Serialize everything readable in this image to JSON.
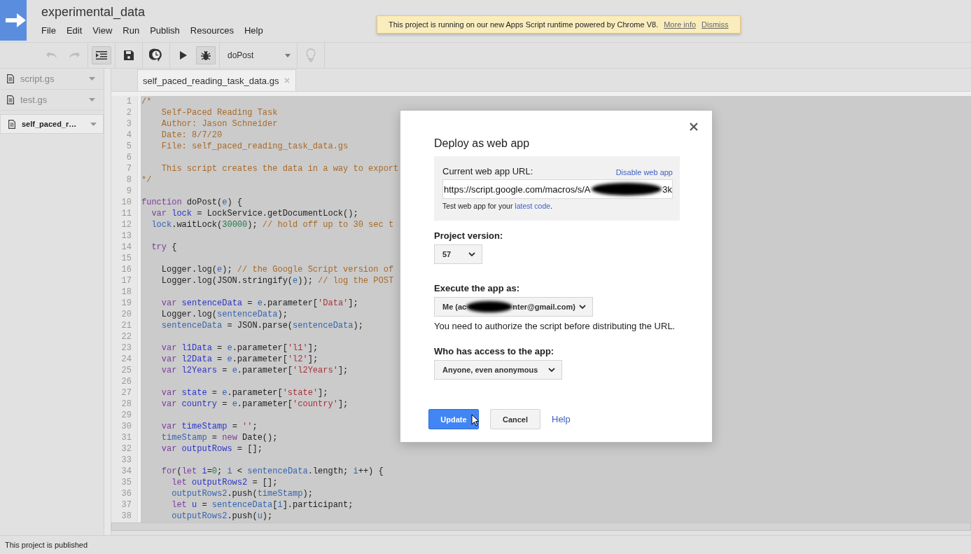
{
  "app": {
    "title": "experimental_data",
    "menu": [
      "File",
      "Edit",
      "View",
      "Run",
      "Publish",
      "Resources",
      "Help"
    ]
  },
  "notice": {
    "text": "This project is running on our new Apps Script runtime powered by Chrome V8.",
    "links": [
      "More info",
      "Dismiss"
    ]
  },
  "toolbar": {
    "buttons": [
      {
        "kind": "undo",
        "disabled": true,
        "pressed": false
      },
      {
        "kind": "redo",
        "disabled": true,
        "pressed": false
      },
      {
        "kind": "indent",
        "disabled": false,
        "pressed": true
      },
      {
        "kind": "save",
        "disabled": false,
        "pressed": false
      },
      {
        "kind": "triggers",
        "disabled": false,
        "pressed": false
      },
      {
        "kind": "run",
        "disabled": false,
        "pressed": false
      },
      {
        "kind": "debug",
        "disabled": false,
        "pressed": true
      },
      {
        "kind": "function",
        "label": "doPost"
      },
      {
        "kind": "hint",
        "disabled": true,
        "pressed": false
      }
    ]
  },
  "files": [
    {
      "name": "script.gs",
      "selected": false
    },
    {
      "name": "test.gs",
      "selected": false
    },
    {
      "name": "self_paced_r…",
      "selected": true
    }
  ],
  "editor": {
    "tab": "self_paced_reading_task_data.gs",
    "lines": [
      {
        "number": "1",
        "segments": [
          {
            "kind": "com",
            "text": "/*"
          }
        ]
      },
      {
        "number": "2",
        "segments": [
          {
            "kind": "com",
            "text": "    Self-Paced Reading Task"
          }
        ]
      },
      {
        "number": "3",
        "segments": [
          {
            "kind": "com",
            "text": "    Author: Jason Schneider"
          }
        ]
      },
      {
        "number": "4",
        "segments": [
          {
            "kind": "com",
            "text": "    Date: 8/7/20"
          }
        ]
      },
      {
        "number": "5",
        "segments": [
          {
            "kind": "com",
            "text": "    File: self_paced_reading_task_data.gs"
          }
        ]
      },
      {
        "number": "6"
      },
      {
        "number": "7",
        "segments": [
          {
            "kind": "com",
            "text": "    This script creates the data in a way to export"
          }
        ]
      },
      {
        "number": "8",
        "segments": [
          {
            "kind": "com",
            "text": "*/"
          }
        ]
      },
      {
        "number": "9"
      },
      {
        "number": "10",
        "segments": [
          {
            "kind": "kw",
            "text": "function"
          },
          {
            "kind": "txt",
            "text": " doPost("
          },
          {
            "kind": "var",
            "text": "e"
          },
          {
            "kind": "txt",
            "text": ") {"
          }
        ]
      },
      {
        "number": "11",
        "segments": [
          {
            "kind": "kw",
            "text": "  var"
          },
          {
            "kind": "def",
            "text": " lock"
          },
          {
            "kind": "txt",
            "text": " = LockService.getDocumentLock();"
          }
        ]
      },
      {
        "number": "12",
        "segments": [
          {
            "kind": "var",
            "text": "  lock"
          },
          {
            "kind": "txt",
            "text": ".waitLock("
          },
          {
            "kind": "num",
            "text": "30000"
          },
          {
            "kind": "txt",
            "text": ");"
          },
          {
            "kind": "com",
            "text": " // hold off up to 30 sec t"
          }
        ]
      },
      {
        "number": "13"
      },
      {
        "number": "14",
        "segments": [
          {
            "kind": "kw",
            "text": "  try"
          },
          {
            "kind": "txt",
            "text": " {"
          }
        ]
      },
      {
        "number": "15"
      },
      {
        "number": "16",
        "segments": [
          {
            "kind": "txt",
            "text": "    Logger.log("
          },
          {
            "kind": "var",
            "text": "e"
          },
          {
            "kind": "txt",
            "text": ");"
          },
          {
            "kind": "com",
            "text": " // the Google Script version of"
          }
        ]
      },
      {
        "number": "17",
        "segments": [
          {
            "kind": "txt",
            "text": "    Logger.log(JSON.stringify("
          },
          {
            "kind": "var",
            "text": "e"
          },
          {
            "kind": "txt",
            "text": "));"
          },
          {
            "kind": "com",
            "text": " // log the POST"
          }
        ]
      },
      {
        "number": "18"
      },
      {
        "number": "19",
        "segments": [
          {
            "kind": "kw",
            "text": "    var"
          },
          {
            "kind": "def",
            "text": " sentenceData"
          },
          {
            "kind": "txt",
            "text": " = "
          },
          {
            "kind": "var",
            "text": "e"
          },
          {
            "kind": "txt",
            "text": ".parameter["
          },
          {
            "kind": "str",
            "text": "'Data'"
          },
          {
            "kind": "txt",
            "text": "];"
          }
        ]
      },
      {
        "number": "20",
        "segments": [
          {
            "kind": "txt",
            "text": "    Logger.log("
          },
          {
            "kind": "var",
            "text": "sentenceData"
          },
          {
            "kind": "txt",
            "text": ");"
          }
        ]
      },
      {
        "number": "21",
        "segments": [
          {
            "kind": "var",
            "text": "    sentenceData"
          },
          {
            "kind": "txt",
            "text": " = JSON.parse("
          },
          {
            "kind": "var",
            "text": "sentenceData"
          },
          {
            "kind": "txt",
            "text": ");"
          }
        ]
      },
      {
        "number": "22"
      },
      {
        "number": "23",
        "segments": [
          {
            "kind": "kw",
            "text": "    var"
          },
          {
            "kind": "def",
            "text": " l1Data"
          },
          {
            "kind": "txt",
            "text": " = "
          },
          {
            "kind": "var",
            "text": "e"
          },
          {
            "kind": "txt",
            "text": ".parameter["
          },
          {
            "kind": "str",
            "text": "'l1'"
          },
          {
            "kind": "txt",
            "text": "];"
          }
        ]
      },
      {
        "number": "24",
        "segments": [
          {
            "kind": "kw",
            "text": "    var"
          },
          {
            "kind": "def",
            "text": " l2Data"
          },
          {
            "kind": "txt",
            "text": " = "
          },
          {
            "kind": "var",
            "text": "e"
          },
          {
            "kind": "txt",
            "text": ".parameter["
          },
          {
            "kind": "str",
            "text": "'l2'"
          },
          {
            "kind": "txt",
            "text": "];"
          }
        ]
      },
      {
        "number": "25",
        "segments": [
          {
            "kind": "kw",
            "text": "    var"
          },
          {
            "kind": "def",
            "text": " l2Years"
          },
          {
            "kind": "txt",
            "text": " = "
          },
          {
            "kind": "var",
            "text": "e"
          },
          {
            "kind": "txt",
            "text": ".parameter["
          },
          {
            "kind": "str",
            "text": "'l2Years'"
          },
          {
            "kind": "txt",
            "text": "];"
          }
        ]
      },
      {
        "number": "26"
      },
      {
        "number": "27",
        "segments": [
          {
            "kind": "kw",
            "text": "    var"
          },
          {
            "kind": "def",
            "text": " state"
          },
          {
            "kind": "txt",
            "text": " = "
          },
          {
            "kind": "var",
            "text": "e"
          },
          {
            "kind": "txt",
            "text": ".parameter["
          },
          {
            "kind": "str",
            "text": "'state'"
          },
          {
            "kind": "txt",
            "text": "];"
          }
        ]
      },
      {
        "number": "28",
        "segments": [
          {
            "kind": "kw",
            "text": "    var"
          },
          {
            "kind": "def",
            "text": " country"
          },
          {
            "kind": "txt",
            "text": " = "
          },
          {
            "kind": "var",
            "text": "e"
          },
          {
            "kind": "txt",
            "text": ".parameter["
          },
          {
            "kind": "str",
            "text": "'country'"
          },
          {
            "kind": "txt",
            "text": "];"
          }
        ]
      },
      {
        "number": "29"
      },
      {
        "number": "30",
        "segments": [
          {
            "kind": "kw",
            "text": "    var"
          },
          {
            "kind": "def",
            "text": " timeStamp"
          },
          {
            "kind": "txt",
            "text": " = "
          },
          {
            "kind": "str",
            "text": "''"
          },
          {
            "kind": "txt",
            "text": ";"
          }
        ]
      },
      {
        "number": "31",
        "segments": [
          {
            "kind": "var",
            "text": "    timeStamp"
          },
          {
            "kind": "txt",
            "text": " = "
          },
          {
            "kind": "kw",
            "text": "new"
          },
          {
            "kind": "txt",
            "text": " Date();"
          }
        ]
      },
      {
        "number": "32",
        "segments": [
          {
            "kind": "kw",
            "text": "    var"
          },
          {
            "kind": "def",
            "text": " outputRows"
          },
          {
            "kind": "txt",
            "text": " = [];"
          }
        ]
      },
      {
        "number": "33"
      },
      {
        "number": "34",
        "segments": [
          {
            "kind": "kw",
            "text": "    for"
          },
          {
            "kind": "txt",
            "text": "("
          },
          {
            "kind": "kw",
            "text": "let"
          },
          {
            "kind": "def",
            "text": " i"
          },
          {
            "kind": "txt",
            "text": "="
          },
          {
            "kind": "num",
            "text": "0"
          },
          {
            "kind": "txt",
            "text": "; "
          },
          {
            "kind": "var",
            "text": "i"
          },
          {
            "kind": "txt",
            "text": " < "
          },
          {
            "kind": "var",
            "text": "sentenceData"
          },
          {
            "kind": "txt",
            "text": ".length; "
          },
          {
            "kind": "var",
            "text": "i"
          },
          {
            "kind": "txt",
            "text": "++) {"
          }
        ]
      },
      {
        "number": "35",
        "segments": [
          {
            "kind": "kw",
            "text": "      let"
          },
          {
            "kind": "def",
            "text": " outputRows2"
          },
          {
            "kind": "txt",
            "text": " = [];"
          }
        ]
      },
      {
        "number": "36",
        "segments": [
          {
            "kind": "var",
            "text": "      outputRows2"
          },
          {
            "kind": "txt",
            "text": ".push("
          },
          {
            "kind": "var",
            "text": "timeStamp"
          },
          {
            "kind": "txt",
            "text": ");"
          }
        ]
      },
      {
        "number": "37",
        "segments": [
          {
            "kind": "kw",
            "text": "      let"
          },
          {
            "kind": "def",
            "text": " u"
          },
          {
            "kind": "txt",
            "text": " = "
          },
          {
            "kind": "var",
            "text": "sentenceData"
          },
          {
            "kind": "txt",
            "text": "["
          },
          {
            "kind": "var",
            "text": "i"
          },
          {
            "kind": "txt",
            "text": "].participant;"
          }
        ]
      },
      {
        "number": "38",
        "segments": [
          {
            "kind": "var",
            "text": "      outputRows2"
          },
          {
            "kind": "txt",
            "text": ".push("
          },
          {
            "kind": "var",
            "text": "u"
          },
          {
            "kind": "txt",
            "text": ");"
          }
        ]
      }
    ]
  },
  "dialog": {
    "title": "Deploy as web app",
    "url_label": "Current web app URL:",
    "disable_link": "Disable web app",
    "url_start": "https://script.google.com/macros/s/A",
    "url_end": "3k",
    "test_note_prefix": "Test web app for your ",
    "test_note_link": "latest code",
    "test_note_suffix": ".",
    "version": {
      "label": "Project version:",
      "value": "57"
    },
    "execute_as": {
      "label": "Execute the app as:",
      "value_start": "Me (ac",
      "value_end": "nter@gmail.com)",
      "note": "You need to authorize the script before distributing the URL."
    },
    "access": {
      "label": "Who has access to the app:",
      "value": "Anyone, even anonymous"
    },
    "buttons": [
      {
        "kind": "primary",
        "label": "Update"
      },
      {
        "kind": "secondary",
        "label": "Cancel"
      },
      {
        "kind": "link",
        "label": "Help"
      }
    ]
  },
  "status_bar": "This project is published"
}
